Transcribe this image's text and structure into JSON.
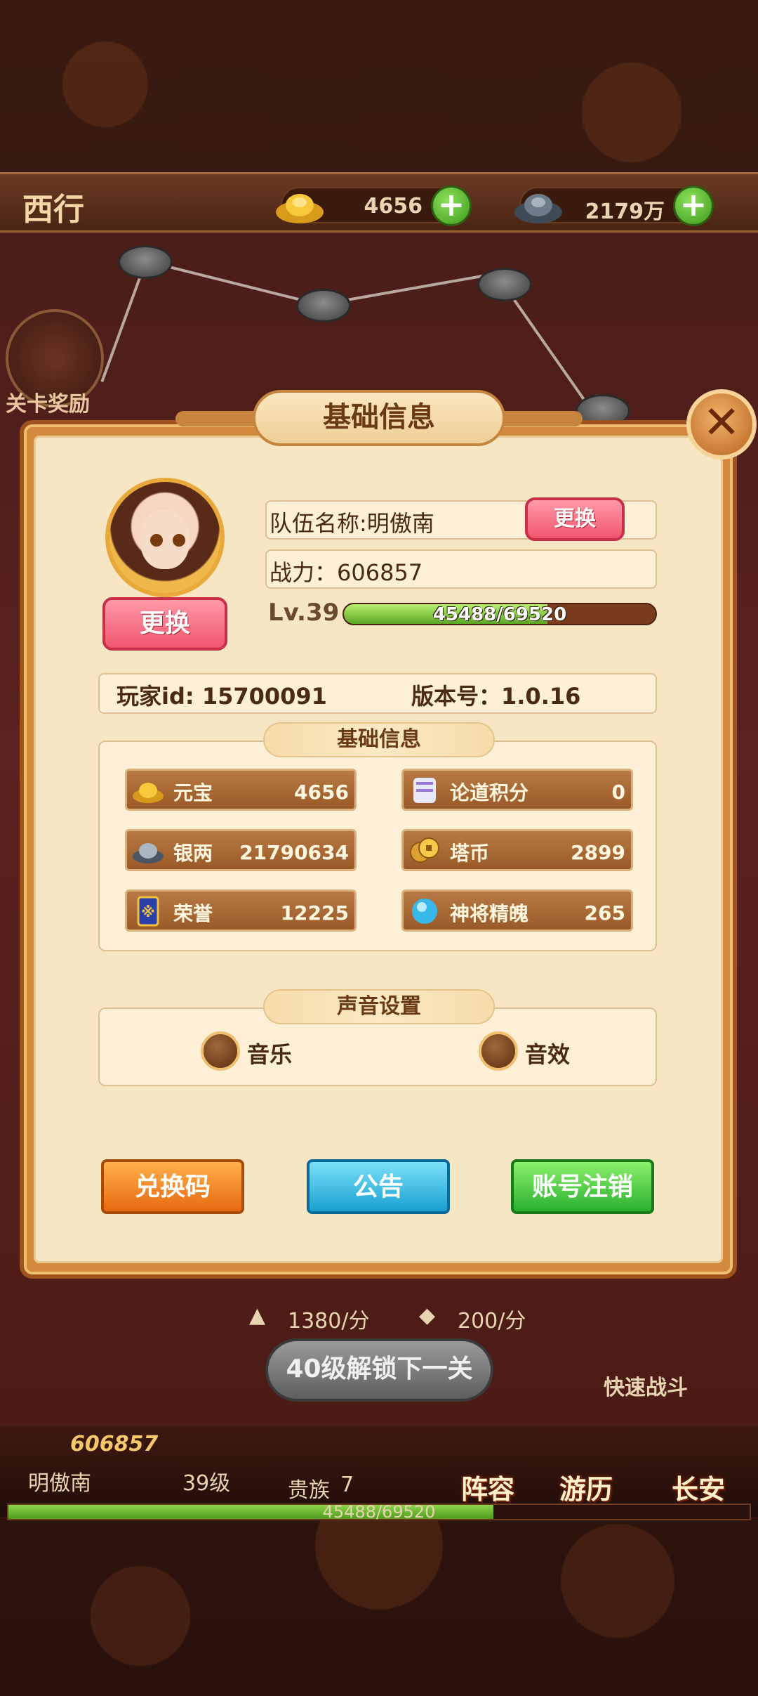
{
  "top_bar": {
    "title": "西行",
    "gold_value": "4656",
    "silver_value": "2179万"
  },
  "map": {
    "side_buttons": [
      "关卡奖励"
    ],
    "rate_silver": "1380/分",
    "rate_spirit": "200/分",
    "unlock_label": "40级解锁下一关",
    "quick_battle": "快速战斗"
  },
  "hud": {
    "power": "606857",
    "player_name": "明傲南",
    "level": "39级",
    "noble_label": "贵族",
    "noble_level": "7",
    "xp_text": "45488/69520",
    "xp_fraction": 0.654,
    "nav": [
      "阵容",
      "游历",
      "长安"
    ]
  },
  "dialog": {
    "title": "基础信息",
    "avatar_change": "更换",
    "team_name": "队伍名称:明傲南",
    "team_change": "更换",
    "power": "战力：606857",
    "level": "Lv.39",
    "xp_text": "45488/69520",
    "xp_fraction": 0.654,
    "player_id": "玩家id: 15700091",
    "version": "版本号：1.0.16",
    "section_resources": "基础信息",
    "resources": [
      {
        "icon": "gold-ingot-icon",
        "label": "元宝",
        "value": "4656"
      },
      {
        "icon": "scroll-icon",
        "label": "论道积分",
        "value": "0"
      },
      {
        "icon": "silver-ingot-icon",
        "label": "银两",
        "value": "21790634"
      },
      {
        "icon": "coin-icon",
        "label": "塔币",
        "value": "2899"
      },
      {
        "icon": "honor-badge-icon",
        "label": "荣誉",
        "value": "12225"
      },
      {
        "icon": "spirit-gem-icon",
        "label": "神将精魄",
        "value": "265"
      }
    ],
    "section_sound": "声音设置",
    "music_label": "音乐",
    "sfx_label": "音效",
    "btn_redeem": "兑换码",
    "btn_notice": "公告",
    "btn_logout": "账号注销"
  }
}
